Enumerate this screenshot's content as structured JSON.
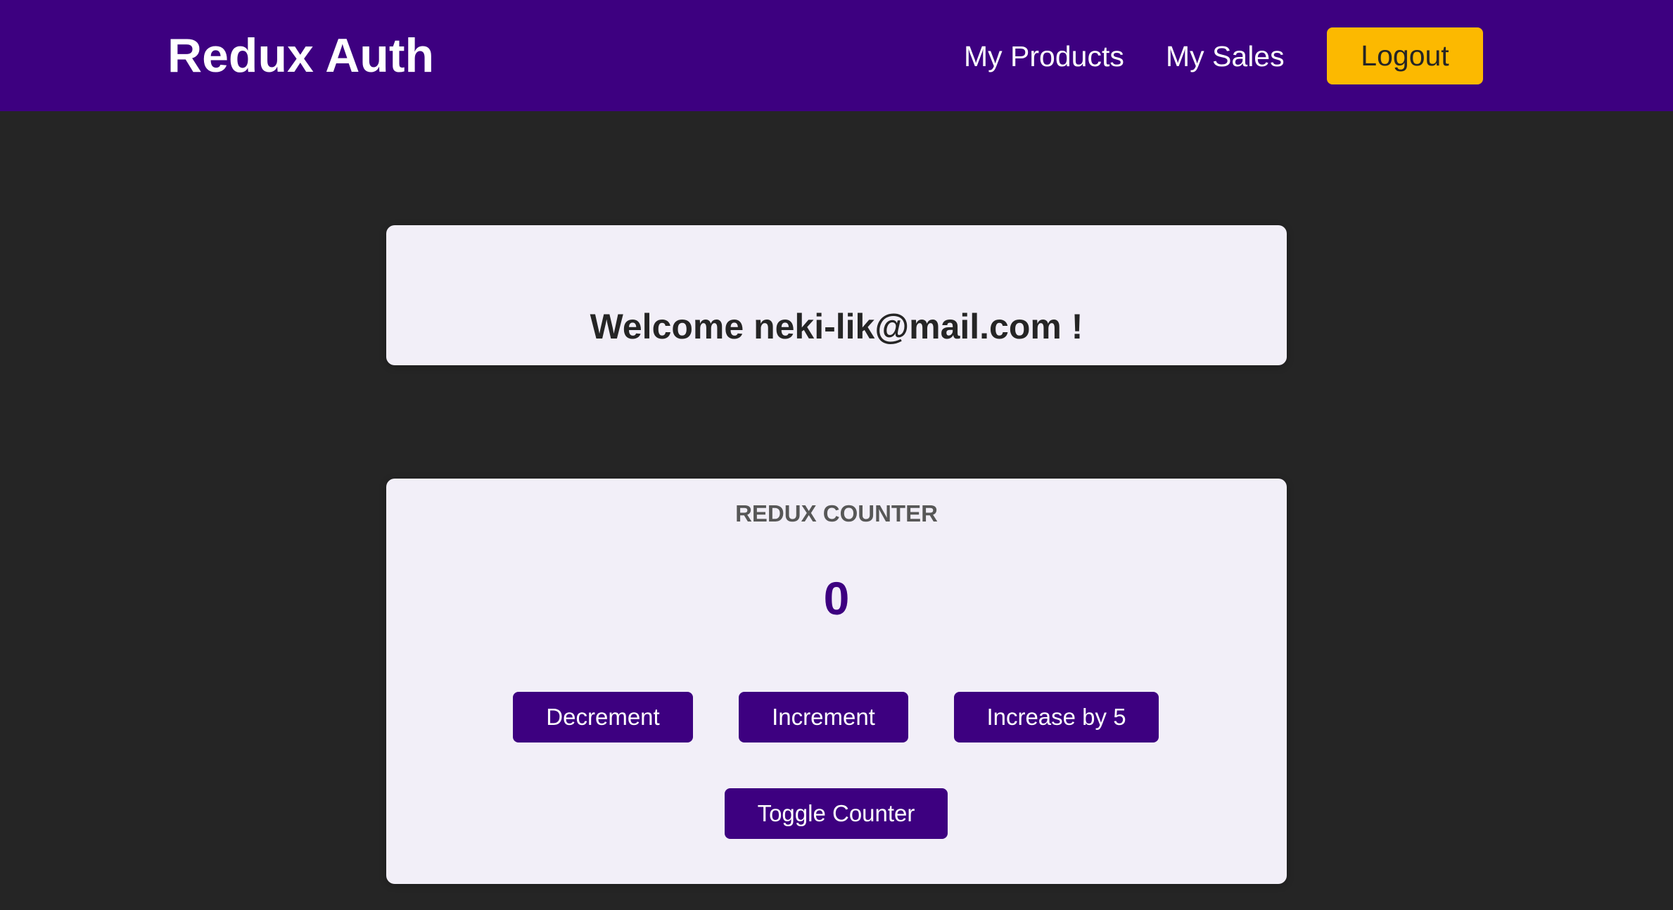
{
  "header": {
    "brand": "Redux Auth",
    "nav": {
      "my_products": "My Products",
      "my_sales": "My Sales"
    },
    "logout_label": "Logout"
  },
  "welcome": {
    "message": "Welcome neki-lik@mail.com !"
  },
  "counter": {
    "title": "REDUX COUNTER",
    "value": "0",
    "buttons": {
      "decrement": "Decrement",
      "increment": "Increment",
      "increase_by_5": "Increase by 5",
      "toggle": "Toggle Counter"
    }
  },
  "colors": {
    "header_bg": "#3d0080",
    "page_bg": "#252525",
    "card_bg": "#f2eff8",
    "accent": "#fcb900",
    "primary": "#3d0080"
  }
}
